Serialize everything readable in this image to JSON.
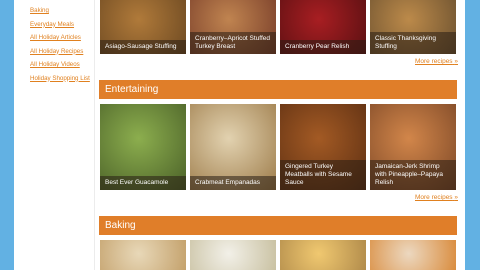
{
  "sidebar": {
    "links": [
      "Baking",
      "Everyday Meals",
      "All Holiday Articles",
      "All Holiday Recipes",
      "All Holiday Videos",
      "Holiday Shopping List"
    ]
  },
  "holiday": {
    "tiles": [
      {
        "caption": "Asiago-Sausage Stuffing",
        "colors": [
          "#b07a3a",
          "#6e4a22"
        ]
      },
      {
        "caption": "Cranberry–Apricot Stuffed Turkey Breast",
        "colors": [
          "#c08450",
          "#7a3f2a"
        ]
      },
      {
        "caption": "Cranberry Pear Relish",
        "colors": [
          "#a81e22",
          "#5a1012"
        ]
      },
      {
        "caption": "Classic Thanksgiving Stuffing",
        "colors": [
          "#bc8a4a",
          "#6d5230"
        ]
      }
    ],
    "more": "More recipes",
    "arrow": "»"
  },
  "entertaining": {
    "title": "Entertaining",
    "tiles": [
      {
        "caption": "Best Ever Guacamole",
        "colors": [
          "#8cae4e",
          "#4a6028"
        ]
      },
      {
        "caption": "Crabmeat Empanadas",
        "colors": [
          "#e2d2b0",
          "#9c7a48"
        ]
      },
      {
        "caption": "Gingered Turkey Meatballs with Sesame Sauce",
        "colors": [
          "#a35a24",
          "#5b2e12"
        ]
      },
      {
        "caption": "Jamaican-Jerk Shrimp with Pineapple–Papaya Relish",
        "colors": [
          "#d2864a",
          "#7a4626"
        ]
      }
    ],
    "more": "More recipes",
    "arrow": "»"
  },
  "baking": {
    "title": "Baking",
    "tiles": [
      {
        "colors": [
          "#e8d8b8",
          "#c3a06a"
        ]
      },
      {
        "colors": [
          "#f2f0e8",
          "#c8c0a0"
        ]
      },
      {
        "colors": [
          "#f0c870",
          "#b08a4a"
        ]
      },
      {
        "colors": [
          "#ecd8c0",
          "#d98a3a"
        ]
      }
    ]
  }
}
